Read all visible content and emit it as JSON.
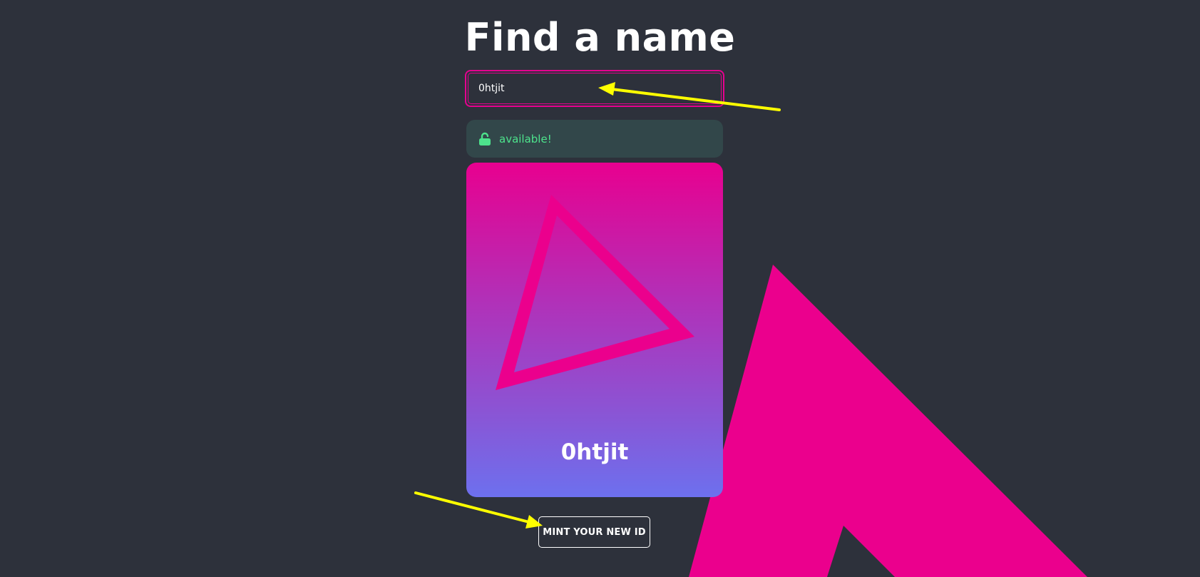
{
  "header": {
    "title": "Find a name"
  },
  "search": {
    "value": "0htjit",
    "placeholder": ""
  },
  "status": {
    "icon": "unlocked-lock-icon",
    "text": "available!",
    "color": "#4de38c"
  },
  "card": {
    "name": "0htjit",
    "gradient_top": "#e8008f",
    "gradient_bottom": "#6d70ee",
    "icon": "triangle-logo-icon"
  },
  "actions": {
    "mint_label": "MINT YOUR NEW ID"
  },
  "colors": {
    "background": "#2d313b",
    "accent": "#e6008f",
    "status_bg": "#32474a",
    "annotation": "#ffff00"
  }
}
